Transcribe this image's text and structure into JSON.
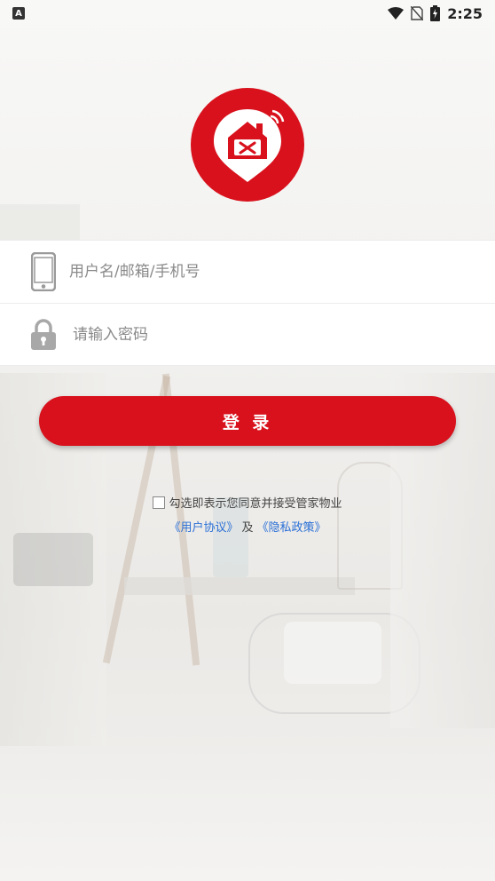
{
  "status_bar": {
    "time": "2:25",
    "app_icon": "A",
    "icons": [
      "wifi-icon",
      "no-sim-icon",
      "battery-charging-icon"
    ]
  },
  "logo": {
    "icon": "house-tools-icon",
    "color": "#d8111c"
  },
  "form": {
    "username": {
      "placeholder": "用户名/邮箱/手机号",
      "value": "",
      "icon": "phone-icon"
    },
    "password": {
      "placeholder": "请输入密码",
      "value": "",
      "icon": "lock-icon"
    }
  },
  "login_button": {
    "label": "登 录",
    "color": "#d8111c"
  },
  "agreement": {
    "checked": false,
    "text": "勾选即表示您同意并接受管家物业",
    "user_agreement_link": "《用户协议》",
    "and": "及",
    "privacy_policy_link": "《隐私政策》",
    "link_color": "#2a6fd6"
  }
}
